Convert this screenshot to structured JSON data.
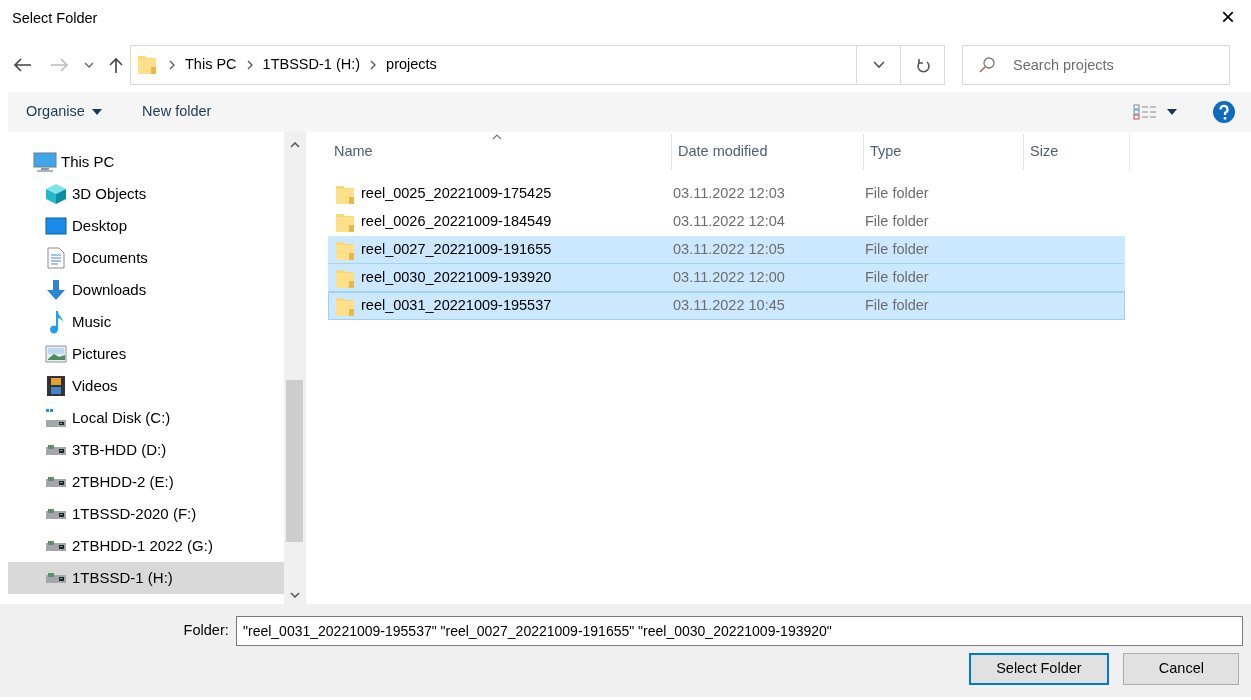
{
  "window": {
    "title": "Select Folder",
    "close": "×"
  },
  "address": {
    "path": [
      {
        "label": "This PC"
      },
      {
        "label": "1TBSSD-1 (H:)"
      },
      {
        "label": "projects"
      }
    ]
  },
  "search": {
    "placeholder": "Search projects"
  },
  "toolbar": {
    "organise": "Organise",
    "new_folder": "New folder"
  },
  "sidebar": {
    "items": [
      {
        "label": "This PC",
        "kind": "pc",
        "selected": false,
        "children": [
          {
            "label": "3D Objects",
            "kind": "objects",
            "selected": false
          },
          {
            "label": "Desktop",
            "kind": "desktop",
            "selected": false
          },
          {
            "label": "Documents",
            "kind": "documents",
            "selected": false
          },
          {
            "label": "Downloads",
            "kind": "downloads",
            "selected": false
          },
          {
            "label": "Music",
            "kind": "music",
            "selected": false
          },
          {
            "label": "Pictures",
            "kind": "pictures",
            "selected": false
          },
          {
            "label": "Videos",
            "kind": "videos",
            "selected": false
          },
          {
            "label": "Local Disk (C:)",
            "kind": "system_drive",
            "selected": false
          },
          {
            "label": "3TB-HDD (D:)",
            "kind": "drive",
            "selected": false
          },
          {
            "label": "2TBHDD-2 (E:)",
            "kind": "drive",
            "selected": false
          },
          {
            "label": "1TBSSD-2020 (F:)",
            "kind": "drive",
            "selected": false
          },
          {
            "label": "2TBHDD-1 2022 (G:)",
            "kind": "drive",
            "selected": false
          },
          {
            "label": "1TBSSD-1 (H:)",
            "kind": "drive",
            "selected": true
          }
        ]
      }
    ]
  },
  "table": {
    "columns": [
      "Name",
      "Date modified",
      "Type",
      "Size"
    ],
    "rows": [
      {
        "name": "reel_0025_20221009-175425",
        "date": "03.11.2022 12:03",
        "type": "File folder",
        "selected": false,
        "focused": false
      },
      {
        "name": "reel_0026_20221009-184549",
        "date": "03.11.2022 12:04",
        "type": "File folder",
        "selected": false,
        "focused": false
      },
      {
        "name": "reel_0027_20221009-191655",
        "date": "03.11.2022 12:05",
        "type": "File folder",
        "selected": true,
        "focused": false
      },
      {
        "name": "reel_0030_20221009-193920",
        "date": "03.11.2022 12:00",
        "type": "File folder",
        "selected": true,
        "focused": false
      },
      {
        "name": "reel_0031_20221009-195537",
        "date": "03.11.2022 10:45",
        "type": "File folder",
        "selected": true,
        "focused": true
      }
    ]
  },
  "footer": {
    "label": "Folder:",
    "value": "\"reel_0031_20221009-195537\" \"reel_0027_20221009-191655\" \"reel_0030_20221009-193920\"",
    "buttons": [
      {
        "label": "Select Folder",
        "default": true
      },
      {
        "label": "Cancel",
        "default": false
      }
    ]
  }
}
